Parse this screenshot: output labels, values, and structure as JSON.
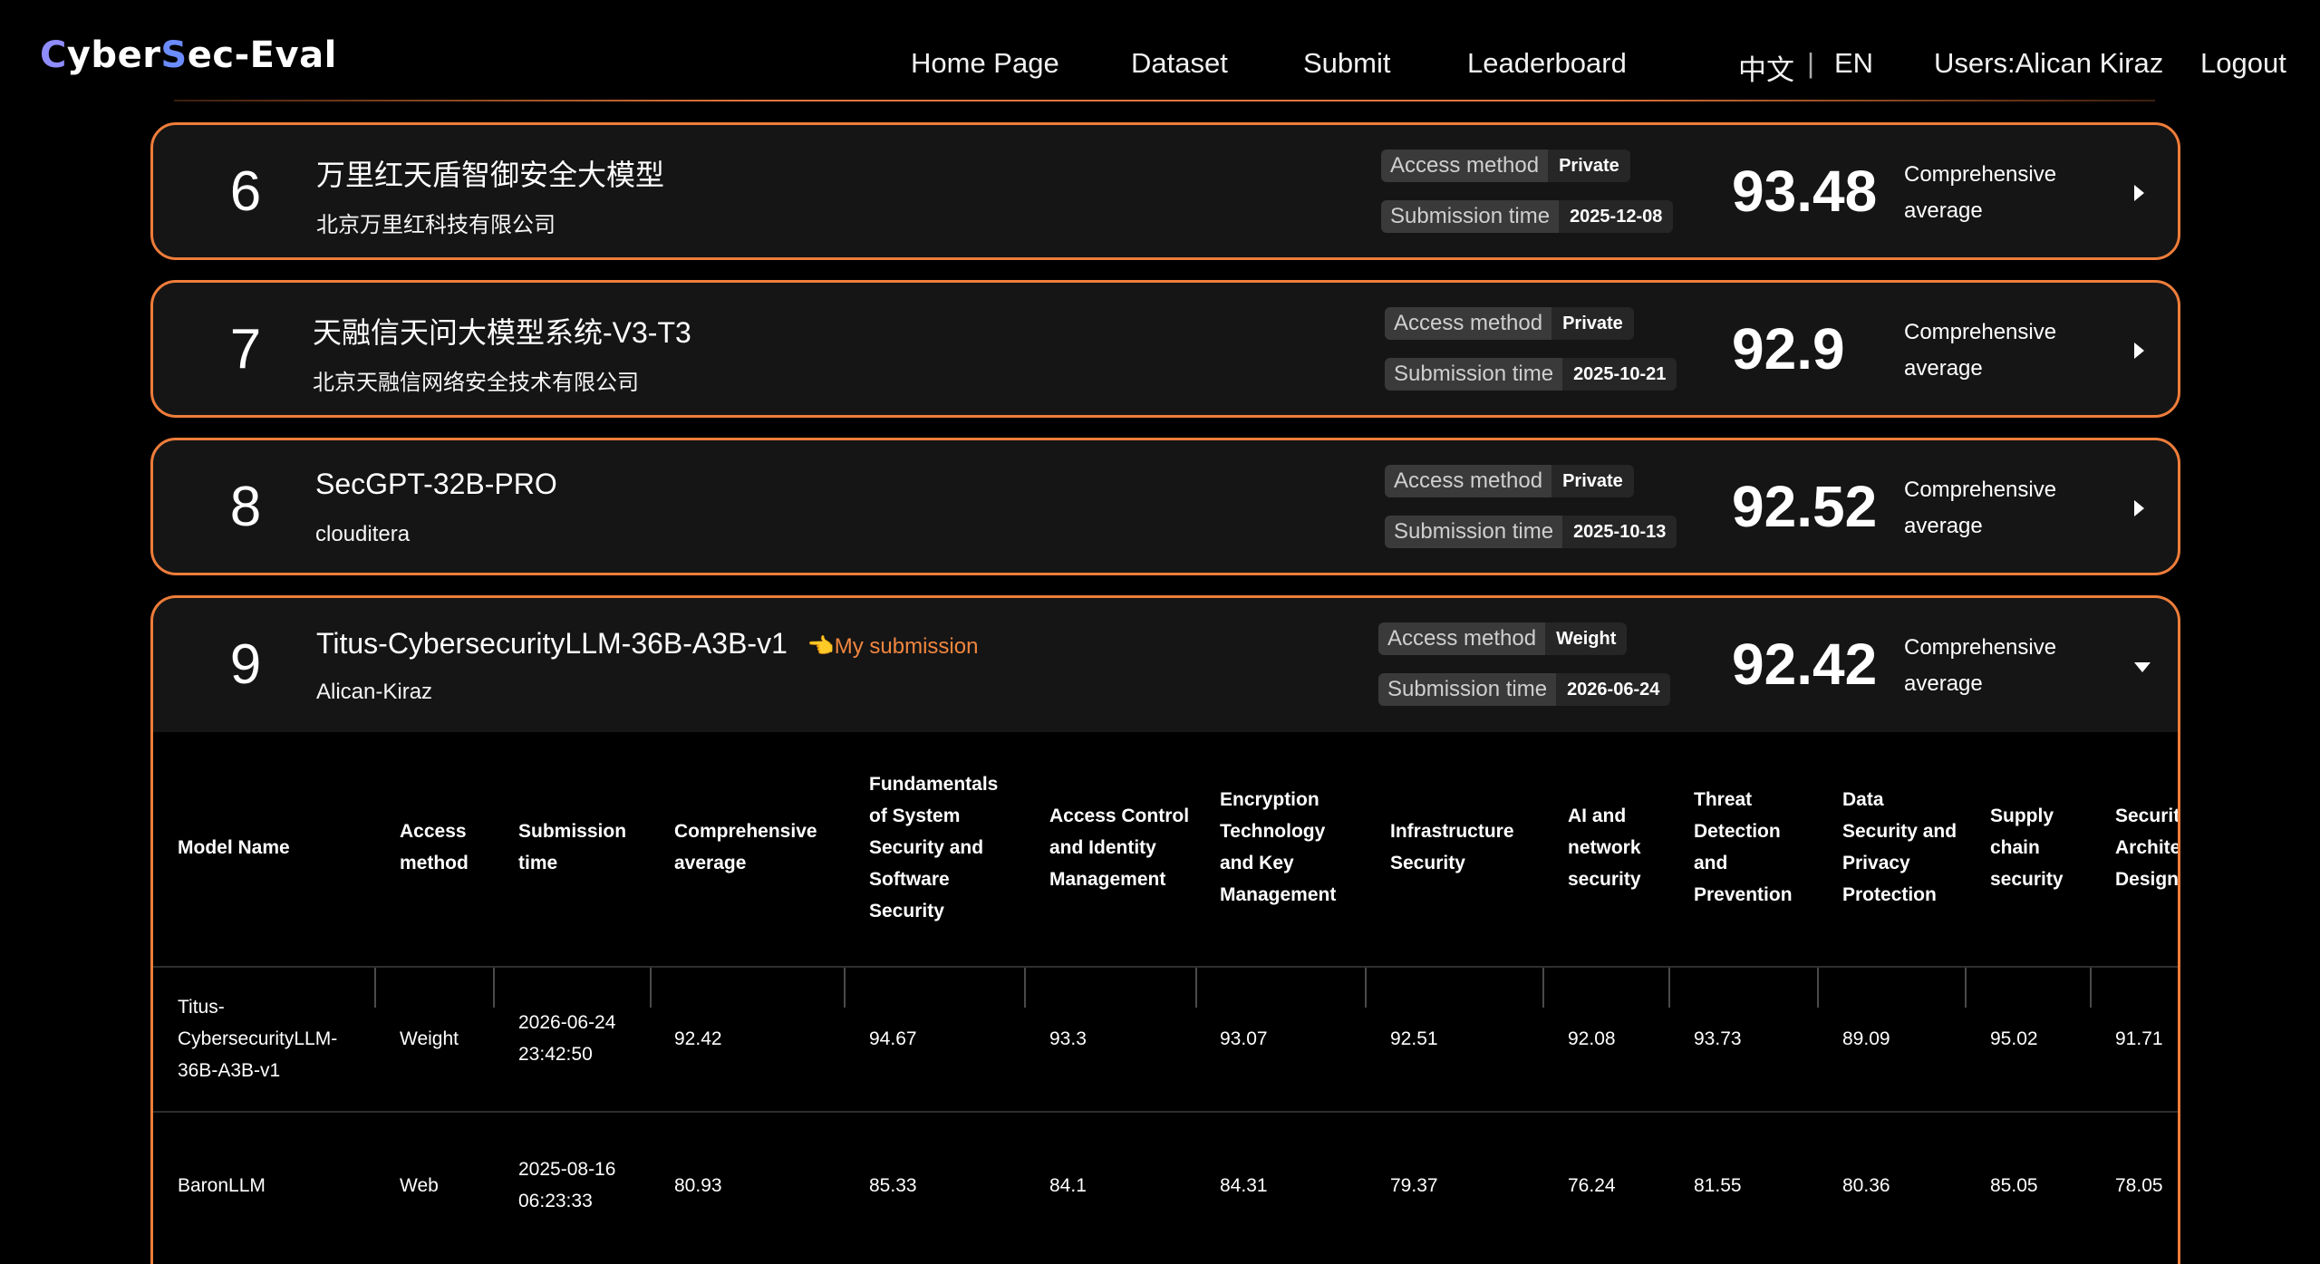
{
  "header": {
    "logo": {
      "c": "C",
      "yber": "yber",
      "s": "S",
      "ec_eval": "ec-Eval"
    },
    "nav": [
      "Home Page",
      "Dataset",
      "Submit",
      "Leaderboard"
    ],
    "lang_zh": "中文",
    "lang_divider": "|",
    "lang_en": "EN",
    "user": "Users:Alican Kiraz",
    "logout": "Logout"
  },
  "labels": {
    "access_method": "Access method",
    "submission_time": "Submission time",
    "score_label": "Comprehensive average",
    "my_submission": "👈My submission"
  },
  "entries": [
    {
      "rank": "6",
      "name": "万里红天盾智御安全大模型",
      "org": "北京万里红科技有限公司",
      "access": "Private",
      "time": "2025-12-08",
      "score": "93.48"
    },
    {
      "rank": "7",
      "name": "天融信天问大模型系统-V3-T3",
      "org": "北京天融信网络安全技术有限公司",
      "access": "Private",
      "time": "2025-10-21",
      "score": "92.9"
    },
    {
      "rank": "8",
      "name": "SecGPT-32B-PRO",
      "org": "clouditera",
      "access": "Private",
      "time": "2025-10-13",
      "score": "92.52"
    },
    {
      "rank": "9",
      "name": "Titus-CybersecurityLLM-36B-A3B-v1",
      "org": "Alican-Kiraz",
      "access": "Weight",
      "time": "2026-06-24",
      "score": "92.42"
    }
  ],
  "table": {
    "headers": [
      "Model Name",
      "Access method",
      "Submission time",
      "Comprehensive average",
      "Fundamentals of System Security and Software Security",
      "Access Control and Identity Management",
      "Encryption Technology and Key Management",
      "Infrastructure Security",
      "AI and network security",
      "Threat Detection and Prevention",
      "Data Security and Privacy Protection",
      "Supply chain security",
      "Security Architecture Design"
    ],
    "rows": [
      [
        "Titus-CybersecurityLLM-36B-A3B-v1",
        "Weight",
        "2026-06-24 23:42:50",
        "92.42",
        "94.67",
        "93.3",
        "93.07",
        "92.51",
        "92.08",
        "93.73",
        "89.09",
        "95.02",
        "91.71"
      ],
      [
        "BaronLLM",
        "Web",
        "2025-08-16 06:23:33",
        "80.93",
        "85.33",
        "84.1",
        "84.31",
        "79.37",
        "76.24",
        "81.55",
        "80.36",
        "85.05",
        "78.05"
      ]
    ]
  },
  "colors": {
    "accent": "#ee7d3a",
    "card_bg": "#151515",
    "page_bg": "#000000"
  }
}
